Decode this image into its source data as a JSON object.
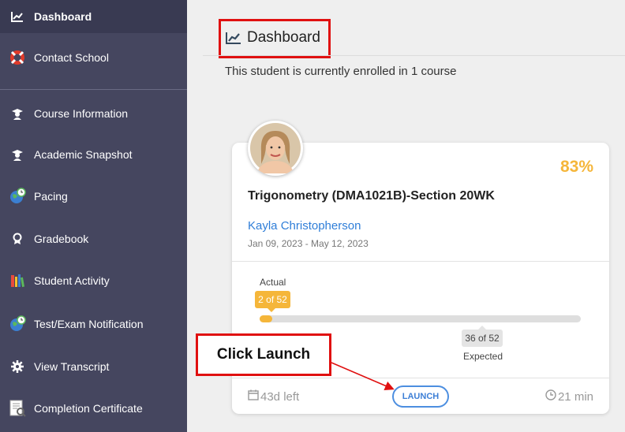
{
  "sidebar": {
    "items": [
      {
        "label": "Dashboard",
        "icon": "chart-line-icon"
      },
      {
        "label": "Contact School",
        "icon": "lifebuoy-icon"
      },
      {
        "label": "Course Information",
        "icon": "graduate-icon"
      },
      {
        "label": "Academic Snapshot",
        "icon": "graduate-icon"
      },
      {
        "label": "Pacing",
        "icon": "globe-clock-icon"
      },
      {
        "label": "Gradebook",
        "icon": "award-icon"
      },
      {
        "label": "Student Activity",
        "icon": "books-icon"
      },
      {
        "label": "Test/Exam Notification",
        "icon": "globe-clock-icon"
      },
      {
        "label": "View Transcript",
        "icon": "gear-icon"
      },
      {
        "label": "Completion Certificate",
        "icon": "certificate-icon"
      }
    ]
  },
  "main": {
    "title": "Dashboard",
    "enrolled_text": "This student is currently enrolled in 1 course"
  },
  "course": {
    "percent": "83%",
    "name": "Trigonometry (DMA1021B)-Section 20WK",
    "teacher": "Kayla Christopherson",
    "dates": "Jan 09, 2023 - May 12, 2023",
    "actual_label": "Actual",
    "actual_value": "2 of 52",
    "actual_fraction": 0.038,
    "expected_value": "36 of 52",
    "expected_label": "Expected",
    "days_left": "43d left",
    "time_left": "21 min",
    "launch_label": "LAUNCH"
  },
  "annotation": {
    "callout_text": "Click Launch"
  },
  "colors": {
    "sidebar_bg": "#45465f",
    "accent_orange": "#f5b63a",
    "link_blue": "#2f7ed8",
    "annotation_red": "#e01010"
  }
}
